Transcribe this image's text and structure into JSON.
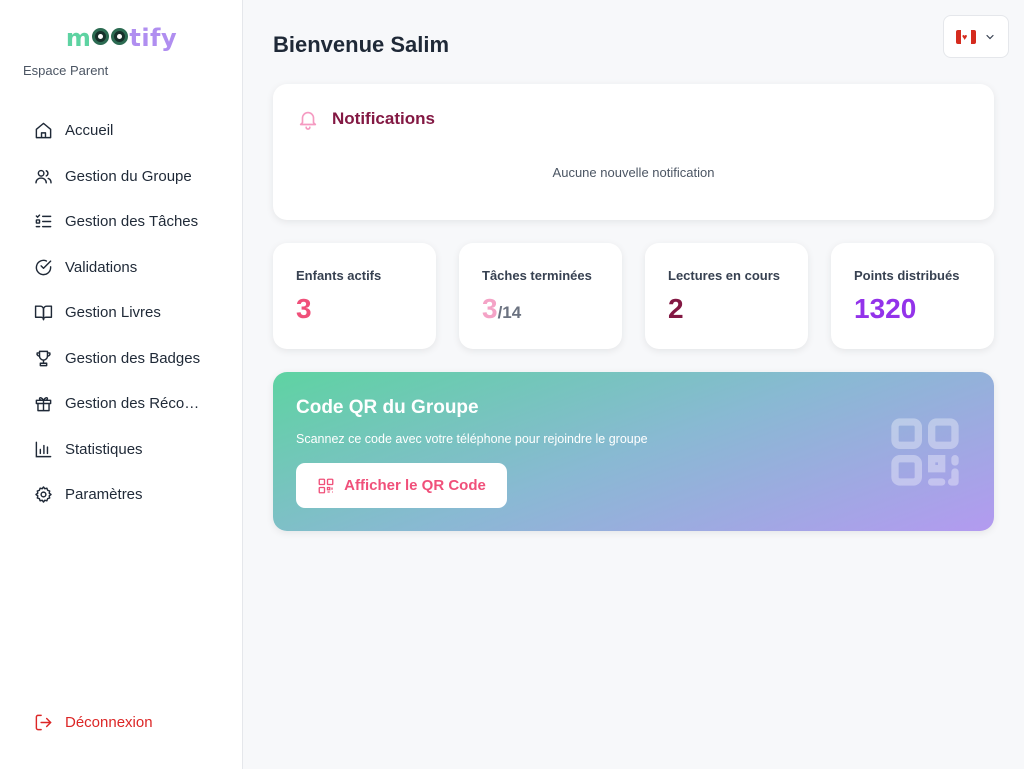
{
  "sidebar": {
    "logo": {
      "part1": "m",
      "part2": "tify"
    },
    "subtitle": "Espace Parent",
    "items": [
      {
        "label": "Accueil",
        "icon": "home-icon"
      },
      {
        "label": "Gestion du Groupe",
        "icon": "users-icon"
      },
      {
        "label": "Gestion des Tâches",
        "icon": "task-list-icon"
      },
      {
        "label": "Validations",
        "icon": "check-circle-icon"
      },
      {
        "label": "Gestion Livres",
        "icon": "book-icon"
      },
      {
        "label": "Gestion des Badges",
        "icon": "trophy-icon"
      },
      {
        "label": "Gestion des Réco…",
        "icon": "gift-icon"
      },
      {
        "label": "Statistiques",
        "icon": "bar-chart-icon"
      },
      {
        "label": "Paramètres",
        "icon": "gear-icon"
      }
    ],
    "logout": "Déconnexion"
  },
  "header": {
    "title": "Bienvenue Salim",
    "language_flag": "canada-flag"
  },
  "notifications": {
    "title": "Notifications",
    "empty": "Aucune nouvelle notification"
  },
  "stats": [
    {
      "label": "Enfants actifs",
      "value": "3",
      "color": "#f0507a"
    },
    {
      "label": "Tâches terminées",
      "value": "3",
      "sub": "/14",
      "color": "#f4a3c6"
    },
    {
      "label": "Lectures en cours",
      "value": "2",
      "color": "#831843"
    },
    {
      "label": "Points distribués",
      "value": "1320",
      "color": "#9333ea"
    }
  ],
  "qr": {
    "title": "Code QR du Groupe",
    "description": "Scannez ce code avec votre téléphone pour rejoindre le groupe",
    "button": "Afficher le QR Code"
  },
  "colors": {
    "accent_pink": "#f0507a",
    "logout_red": "#dc2626",
    "notif_title": "#831843"
  }
}
